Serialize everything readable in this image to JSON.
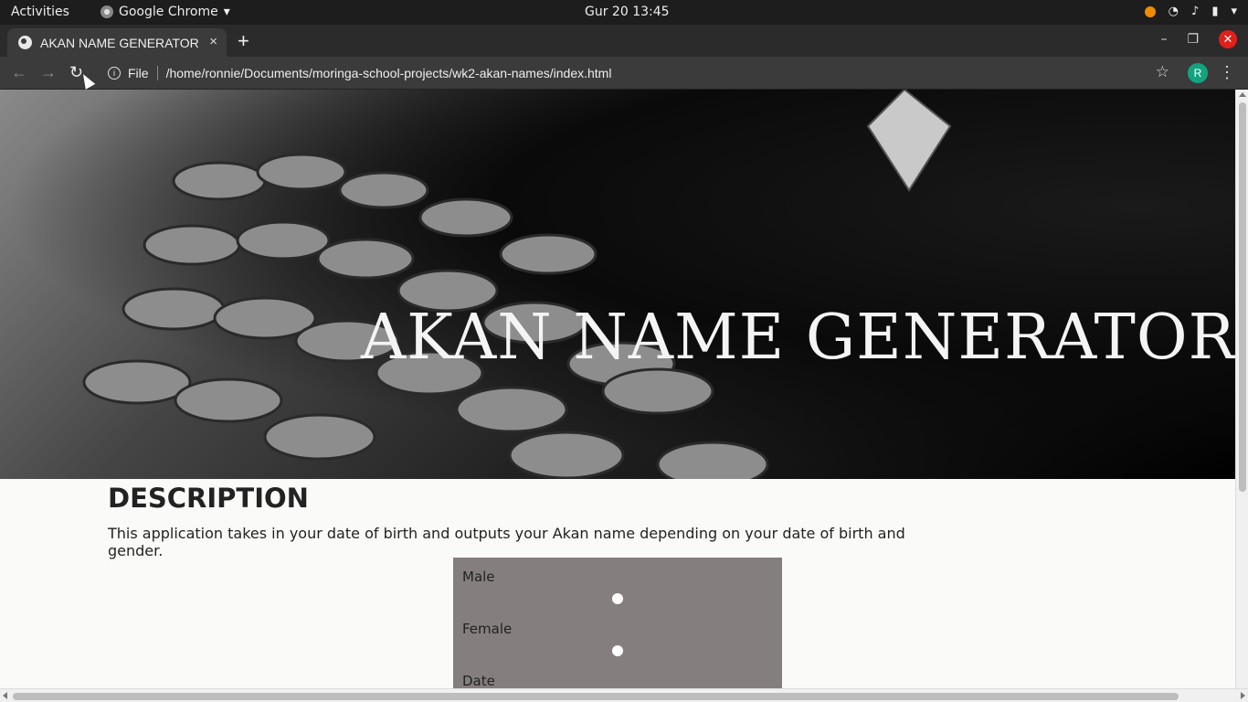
{
  "system_bar": {
    "activities": "Activities",
    "app_name": "Google Chrome",
    "clock": "Gur 20  13:45"
  },
  "browser": {
    "tab_title": "AKAN NAME GENERATOR",
    "tab_close": "×",
    "new_tab": "+",
    "scheme": "File",
    "url": "/home/ronnie/Documents/moringa-school-projects/wk2-akan-names/index.html",
    "profile_initial": "R"
  },
  "hero": {
    "title": "AKAN NAME GENERATOR ....."
  },
  "description": {
    "heading": "DESCRIPTION",
    "text": "This application takes in your date of birth and outputs your Akan name depending on your date of birth and gender."
  },
  "form": {
    "male_label": "Male",
    "female_label": "Female",
    "date_label": "Date"
  },
  "colors": {
    "form_background": "#857e7e",
    "profile_avatar": "#14a37f",
    "close_button": "#e0201b"
  }
}
